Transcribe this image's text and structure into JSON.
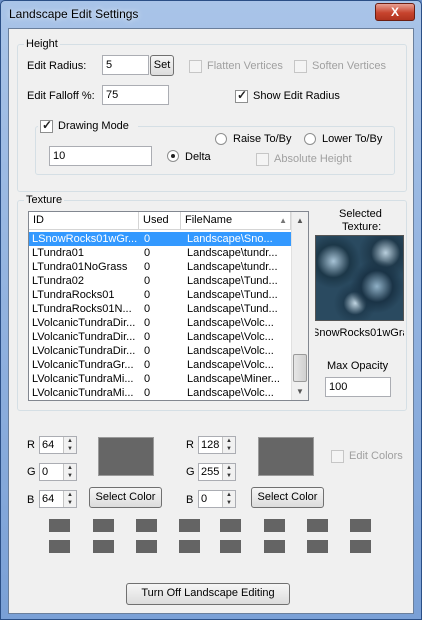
{
  "window": {
    "title": "Landscape Edit Settings",
    "close_label": "X"
  },
  "height_group": {
    "label": "Height",
    "edit_radius_label": "Edit Radius:",
    "edit_radius_value": "5",
    "set_label": "Set",
    "flatten_label": "Flatten Vertices",
    "soften_label": "Soften Vertices",
    "edit_falloff_label": "Edit Falloff %:",
    "edit_falloff_value": "75",
    "show_edit_radius_label": "Show Edit Radius",
    "drawing_mode": {
      "label": "Drawing Mode",
      "value": "10",
      "raise_label": "Raise To/By",
      "lower_label": "Lower To/By",
      "delta_label": "Delta",
      "absolute_label": "Absolute Height"
    }
  },
  "texture_group": {
    "label": "Texture",
    "columns": [
      "ID",
      "Used",
      "FileName"
    ],
    "rows": [
      {
        "id": "LSnowRocks01wGr...",
        "used": "0",
        "file": "Landscape\\Sno..."
      },
      {
        "id": "LTundra01",
        "used": "0",
        "file": "Landscape\\tundr..."
      },
      {
        "id": "LTundra01NoGrass",
        "used": "0",
        "file": "Landscape\\tundr..."
      },
      {
        "id": "LTundra02",
        "used": "0",
        "file": "Landscape\\Tund..."
      },
      {
        "id": "LTundraRocks01",
        "used": "0",
        "file": "Landscape\\Tund..."
      },
      {
        "id": "LTundraRocks01N...",
        "used": "0",
        "file": "Landscape\\Tund..."
      },
      {
        "id": "LVolcanicTundraDir...",
        "used": "0",
        "file": "Landscape\\Volc..."
      },
      {
        "id": "LVolcanicTundraDir...",
        "used": "0",
        "file": "Landscape\\Volc..."
      },
      {
        "id": "LVolcanicTundraDir...",
        "used": "0",
        "file": "Landscape\\Volc..."
      },
      {
        "id": "LVolcanicTundraGr...",
        "used": "0",
        "file": "Landscape\\Volc..."
      },
      {
        "id": "LVolcanicTundraMi...",
        "used": "0",
        "file": "Landscape\\Miner..."
      },
      {
        "id": "LVolcanicTundraMi...",
        "used": "0",
        "file": "Landscape\\Volc..."
      }
    ],
    "selected_label_1": "Selected",
    "selected_label_2": "Texture:",
    "selected_name": "SnowRocks01wGra",
    "max_opacity_label": "Max Opacity",
    "max_opacity_value": "100"
  },
  "colors": {
    "left": {
      "r": "64",
      "g": "0",
      "b": "64"
    },
    "right": {
      "r": "128",
      "g": "255",
      "b": "0"
    },
    "labels": {
      "r": "R",
      "g": "G",
      "b": "B"
    },
    "select_color_label": "Select Color",
    "edit_colors_label": "Edit Colors"
  },
  "footer": {
    "turn_off_label": "Turn Off Landscape Editing"
  }
}
